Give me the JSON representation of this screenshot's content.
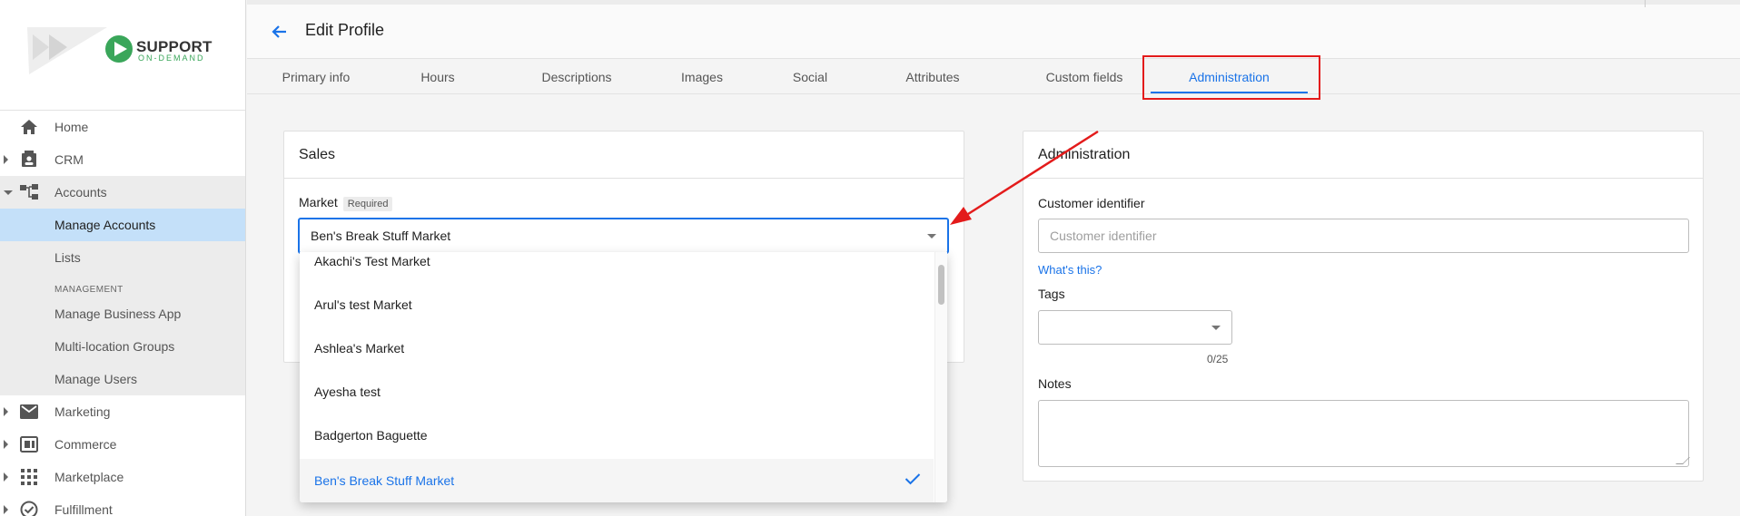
{
  "brand": {
    "name": "SUPPORT",
    "tagline": "ON-DEMAND",
    "accent": "#3aa65a"
  },
  "sidebar": {
    "items": [
      {
        "label": "Home",
        "icon": "home-icon"
      },
      {
        "label": "CRM",
        "icon": "contact-icon"
      },
      {
        "label": "Accounts",
        "icon": "hierarchy-icon"
      },
      {
        "label": "Marketing",
        "icon": "mail-icon"
      },
      {
        "label": "Commerce",
        "icon": "commerce-icon"
      },
      {
        "label": "Marketplace",
        "icon": "grid-icon"
      },
      {
        "label": "Fulfillment",
        "icon": "check-circle-icon"
      }
    ],
    "accounts_sub": {
      "manage_accounts": "Manage Accounts",
      "lists": "Lists",
      "management_header": "MANAGEMENT",
      "manage_business_app": "Manage Business App",
      "multi_location_groups": "Multi-location Groups",
      "manage_users": "Manage Users"
    }
  },
  "header": {
    "title": "Edit Profile"
  },
  "tabs": [
    {
      "label": "Primary info"
    },
    {
      "label": "Hours"
    },
    {
      "label": "Descriptions"
    },
    {
      "label": "Images"
    },
    {
      "label": "Social"
    },
    {
      "label": "Attributes"
    },
    {
      "label": "Custom fields"
    },
    {
      "label": "Administration",
      "active": true
    }
  ],
  "sales_card": {
    "title": "Sales",
    "market_label": "Market",
    "required_badge": "Required",
    "selected_value": "Ben's Break Stuff Market"
  },
  "dropdown": {
    "options": [
      "Akachi's Test Market",
      "Arul's test Market",
      "Ashlea's Market",
      "Ayesha test",
      "Badgerton Baguette",
      "Ben's Break Stuff Market"
    ],
    "selected_index": 5
  },
  "admin_card": {
    "title": "Administration",
    "customer_identifier_label": "Customer identifier",
    "customer_identifier_placeholder": "Customer identifier",
    "whats_this": "What's this?",
    "tags_label": "Tags",
    "tags_counter": "0/25",
    "notes_label": "Notes"
  },
  "colors": {
    "accent": "#1a73e8",
    "annotation": "#e31b1b",
    "active_nav": "#c4e0f9"
  }
}
